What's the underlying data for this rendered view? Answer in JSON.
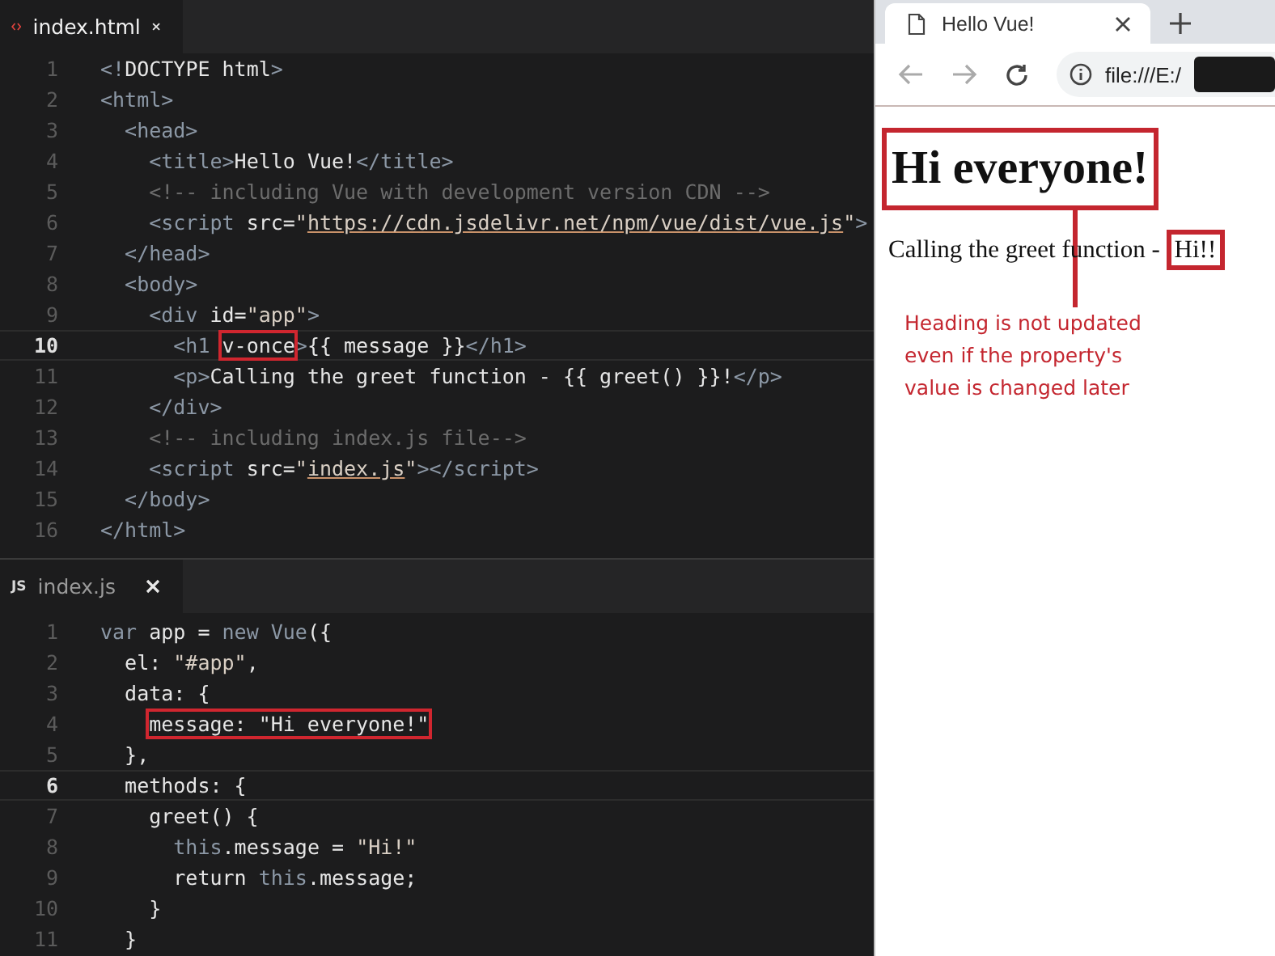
{
  "editors": [
    {
      "tab": {
        "label": "index.html",
        "selected": true
      },
      "lines": [
        {
          "number": "1",
          "active": false,
          "tokens": [
            {
              "kind": "tag",
              "text": "<!"
            },
            {
              "kind": "text",
              "text": "DOCTYPE html"
            },
            {
              "kind": "tag",
              "text": ">"
            }
          ]
        },
        {
          "number": "2",
          "active": false,
          "tokens": [
            {
              "kind": "tag",
              "text": "<html>"
            }
          ]
        },
        {
          "number": "3",
          "active": false,
          "tokens": [
            {
              "kind": "tag",
              "text": "  <head>"
            }
          ]
        },
        {
          "number": "4",
          "active": false,
          "tokens": [
            {
              "kind": "tag",
              "text": "    <title>"
            },
            {
              "kind": "text",
              "text": "Hello Vue!"
            },
            {
              "kind": "tag",
              "text": "</title>"
            }
          ]
        },
        {
          "number": "5",
          "active": false,
          "tokens": [
            {
              "kind": "comment",
              "text": "    <!-- including Vue with development version CDN -->"
            }
          ]
        },
        {
          "number": "6",
          "active": false,
          "tokens": [
            {
              "kind": "tag",
              "text": "    <script "
            },
            {
              "kind": "text",
              "text": "src="
            },
            {
              "kind": "string",
              "text": "\""
            },
            {
              "kind": "link",
              "text": "https://cdn.jsdelivr.net/npm/vue/dist/vue.js"
            },
            {
              "kind": "string",
              "text": "\""
            },
            {
              "kind": "tag",
              "text": ">"
            }
          ]
        },
        {
          "number": "7",
          "active": false,
          "tokens": [
            {
              "kind": "tag",
              "text": "  </head>"
            }
          ]
        },
        {
          "number": "8",
          "active": false,
          "tokens": [
            {
              "kind": "tag",
              "text": "  <body>"
            }
          ]
        },
        {
          "number": "9",
          "active": false,
          "tokens": [
            {
              "kind": "tag",
              "text": "    <div "
            },
            {
              "kind": "text",
              "text": "id="
            },
            {
              "kind": "string",
              "text": "\"app\""
            },
            {
              "kind": "tag",
              "text": ">"
            }
          ]
        },
        {
          "number": "10",
          "active": true,
          "tokens": [
            {
              "kind": "tag",
              "text": "      <h1 "
            },
            {
              "kind": "text",
              "text": "v-once",
              "highlighted": true
            },
            {
              "kind": "tag",
              "text": ">"
            },
            {
              "kind": "text",
              "text": "{{ message }}"
            },
            {
              "kind": "tag",
              "text": "</h1>"
            }
          ]
        },
        {
          "number": "11",
          "active": false,
          "tokens": [
            {
              "kind": "tag",
              "text": "      <p>"
            },
            {
              "kind": "text",
              "text": "Calling the greet function - {{ greet() }}!"
            },
            {
              "kind": "tag",
              "text": "</p>"
            }
          ]
        },
        {
          "number": "12",
          "active": false,
          "tokens": [
            {
              "kind": "tag",
              "text": "    </div>"
            }
          ]
        },
        {
          "number": "13",
          "active": false,
          "tokens": [
            {
              "kind": "comment",
              "text": "    <!-- including index.js file-->"
            }
          ]
        },
        {
          "number": "14",
          "active": false,
          "tokens": [
            {
              "kind": "tag",
              "text": "    <script "
            },
            {
              "kind": "text",
              "text": "src="
            },
            {
              "kind": "string",
              "text": "\""
            },
            {
              "kind": "link",
              "text": "index.js"
            },
            {
              "kind": "string",
              "text": "\""
            },
            {
              "kind": "tag",
              "text": "></script>"
            }
          ]
        },
        {
          "number": "15",
          "active": false,
          "tokens": [
            {
              "kind": "tag",
              "text": "  </body>"
            }
          ]
        },
        {
          "number": "16",
          "active": false,
          "tokens": [
            {
              "kind": "tag",
              "text": "</html>"
            }
          ]
        }
      ]
    },
    {
      "tab": {
        "label": "index.js",
        "icon_text": "JS",
        "selected": false
      },
      "lines": [
        {
          "number": "1",
          "active": false,
          "tokens": [
            {
              "kind": "keyword",
              "text": "var "
            },
            {
              "kind": "text",
              "text": "app = "
            },
            {
              "kind": "keyword",
              "text": "new Vue"
            },
            {
              "kind": "text",
              "text": "({"
            }
          ]
        },
        {
          "number": "2",
          "active": false,
          "tokens": [
            {
              "kind": "text",
              "text": "  el: "
            },
            {
              "kind": "string",
              "text": "\"#app\""
            },
            {
              "kind": "text",
              "text": ","
            }
          ]
        },
        {
          "number": "3",
          "active": false,
          "tokens": [
            {
              "kind": "text",
              "text": "  data: {"
            }
          ]
        },
        {
          "number": "4",
          "active": false,
          "indented": true,
          "tokens": [
            {
              "kind": "text",
              "text": "message: \"Hi everyone!\"",
              "highlighted": true
            }
          ]
        },
        {
          "number": "5",
          "active": false,
          "tokens": [
            {
              "kind": "text",
              "text": "  },"
            }
          ]
        },
        {
          "number": "6",
          "active": true,
          "tokens": [
            {
              "kind": "text",
              "text": "  methods: {"
            }
          ]
        },
        {
          "number": "7",
          "active": false,
          "tokens": [
            {
              "kind": "text",
              "text": "    greet() {"
            }
          ]
        },
        {
          "number": "8",
          "active": false,
          "tokens": [
            {
              "kind": "keyword",
              "text": "      this"
            },
            {
              "kind": "text",
              "text": ".message = "
            },
            {
              "kind": "string",
              "text": "\"Hi!\""
            }
          ]
        },
        {
          "number": "9",
          "active": false,
          "tokens": [
            {
              "kind": "text",
              "text": "      return "
            },
            {
              "kind": "keyword",
              "text": "this"
            },
            {
              "kind": "text",
              "text": ".message;"
            }
          ]
        },
        {
          "number": "10",
          "active": false,
          "tokens": [
            {
              "kind": "text",
              "text": "    }"
            }
          ]
        },
        {
          "number": "11",
          "active": false,
          "tokens": [
            {
              "kind": "text",
              "text": "  }"
            }
          ]
        }
      ]
    }
  ],
  "browser": {
    "tabs": [
      {
        "title": "Hello Vue!",
        "selected": true
      }
    ],
    "address": "file:///E:/",
    "page": {
      "heading": {
        "text": "Hi everyone!",
        "highlighted": true
      },
      "paragraph": {
        "text": "Calling the greet function - ",
        "result": "Hi!!",
        "result_highlighted": true
      },
      "annotation": "Heading is not updated even if the property's value is changed later"
    }
  }
}
